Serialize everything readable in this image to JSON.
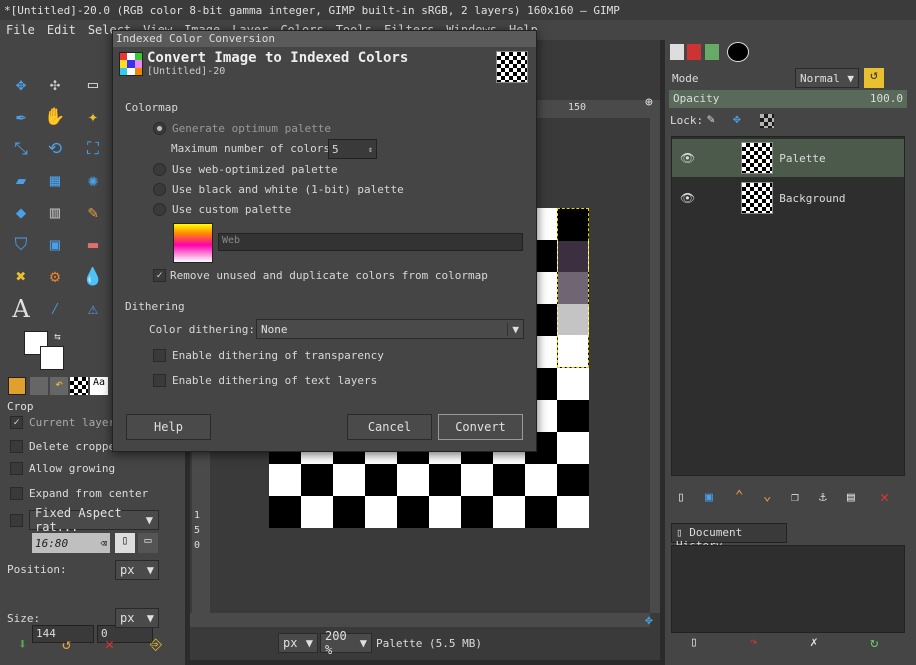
{
  "window": {
    "title": "*[Untitled]-20.0 (RGB color 8-bit gamma integer, GIMP built-in sRGB, 2 layers) 160x160 – GIMP"
  },
  "menu": [
    "File",
    "Edit",
    "Select",
    "View",
    "Image",
    "Layer",
    "Colors",
    "Tools",
    "Filters",
    "Windows",
    "Help"
  ],
  "tool_options": {
    "title": "Crop",
    "current_layer": "Current layer",
    "delete_cropped": "Delete cropped",
    "allow_growing": "Allow growing",
    "expand_from_center": "Expand from center",
    "fixed_aspect": "Fixed Aspect rat...",
    "aspect_value": "16:80",
    "position_label": "Position:",
    "position_unit": "px",
    "pos_x": "144",
    "pos_y": "0",
    "size_label": "Size:",
    "size_unit": "px"
  },
  "dialog": {
    "window_title": "Indexed Color Conversion",
    "heading": "Convert Image to Indexed Colors",
    "subheading": "[Untitled]-20",
    "colormap_label": "Colormap",
    "generate_optimum": "Generate optimum palette",
    "max_colors_label": "Maximum number of colors:",
    "max_colors_value": "5",
    "web_optimized": "Use web-optimized palette",
    "black_white": "Use black and white (1-bit) palette",
    "custom_palette": "Use custom palette",
    "palette_name": "Web",
    "remove_unused": "Remove unused and duplicate colors from colormap",
    "dithering_label": "Dithering",
    "color_dithering_label": "Color dithering:",
    "color_dithering_value": "None",
    "dither_transparency": "Enable dithering of transparency",
    "dither_text": "Enable dithering of text layers",
    "help": "Help",
    "cancel": "Cancel",
    "convert": "Convert"
  },
  "canvas": {
    "ruler_mark": "150",
    "ruler_v": [
      "1",
      "5",
      "0"
    ],
    "unit": "px",
    "zoom": "200 %",
    "status": "Palette (5.5 MB)",
    "palette_colors": [
      "#000000",
      "#3c3040",
      "#6f6573",
      "#c4c4c4",
      "#ffffff"
    ]
  },
  "layers": {
    "mode_label": "Mode",
    "mode_value": "Normal",
    "opacity_label": "Opacity",
    "opacity_value": "100.0",
    "lock_label": "Lock:",
    "items": [
      {
        "name": "Palette"
      },
      {
        "name": "Background"
      }
    ],
    "history_title": "Document History"
  }
}
